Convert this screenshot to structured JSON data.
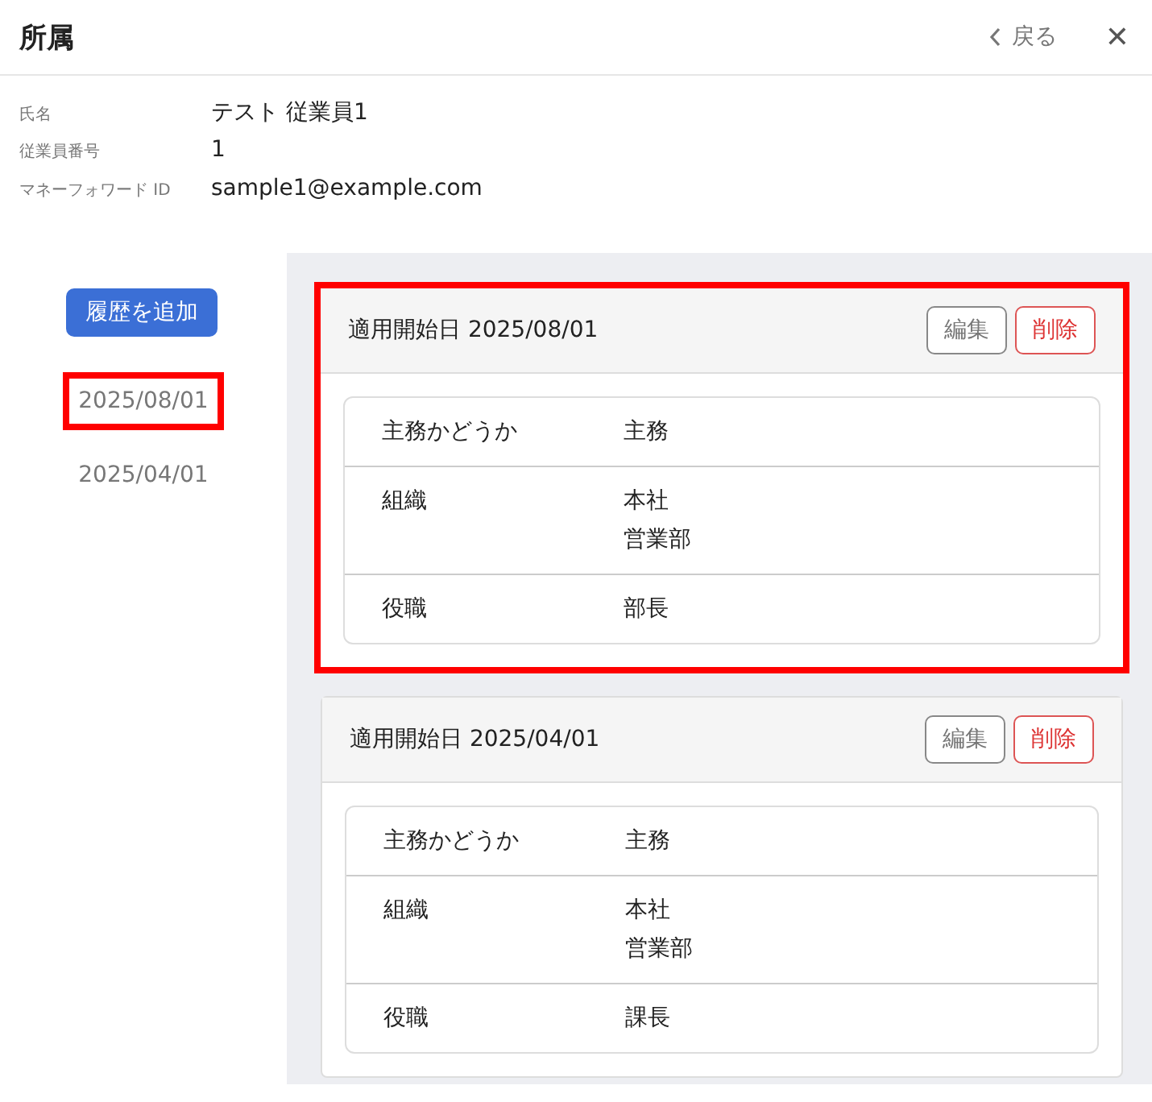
{
  "header": {
    "title": "所属",
    "back_label": "戻る",
    "close_label": "✕"
  },
  "employee": [
    {
      "label": "氏名",
      "value": "テスト 従業員1"
    },
    {
      "label": "従業員番号",
      "value": "1"
    },
    {
      "label": "マネーフォワード ID",
      "value": "sample1@example.com"
    }
  ],
  "add_button": "履歴を追加",
  "history": [
    {
      "date": "2025/08/01",
      "highlighted": true
    },
    {
      "date": "2025/04/01",
      "highlighted": false
    }
  ],
  "records": [
    {
      "title": "適用開始日 2025/08/01",
      "highlighted": true,
      "edit": "編集",
      "delete": "削除",
      "rows": [
        {
          "label": "主務かどうか",
          "values": [
            "主務"
          ]
        },
        {
          "label": "組織",
          "values": [
            "本社",
            "営業部"
          ]
        },
        {
          "label": "役職",
          "values": [
            "部長"
          ]
        }
      ]
    },
    {
      "title": "適用開始日 2025/04/01",
      "highlighted": false,
      "edit": "編集",
      "delete": "削除",
      "rows": [
        {
          "label": "主務かどうか",
          "values": [
            "主務"
          ]
        },
        {
          "label": "組織",
          "values": [
            "本社",
            "営業部"
          ]
        },
        {
          "label": "役職",
          "values": [
            "課長"
          ]
        }
      ]
    }
  ]
}
